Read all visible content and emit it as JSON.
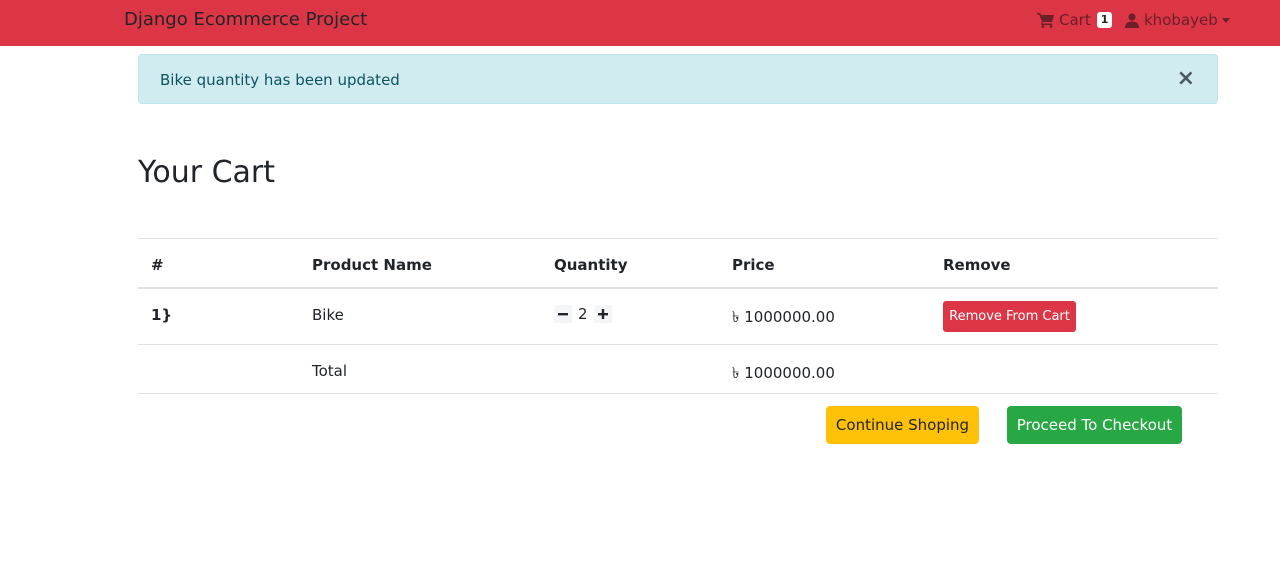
{
  "navbar": {
    "brand": "Django Ecommerce Project",
    "cart_label": "Cart",
    "cart_count": "1",
    "username": "khobayeb"
  },
  "alert": {
    "message": "Bike quantity has been updated",
    "close_glyph": "×"
  },
  "page_title": "Your Cart",
  "table": {
    "headers": [
      "#",
      "Product Name",
      "Quantity",
      "Price",
      "Remove"
    ],
    "rows": [
      {
        "index": "1}",
        "product": "Bike",
        "quantity": "2",
        "price": "৳ 1000000.00",
        "remove_label": "Remove From Cart"
      }
    ],
    "total_label": "Total",
    "total_value": "৳ 1000000.00"
  },
  "actions": {
    "continue_label": "Continue Shoping",
    "checkout_label": "Proceed To Checkout"
  },
  "colors": {
    "navbar": "#dc3545",
    "alert_bg": "#d1ecf1",
    "continue": "#ffc107",
    "checkout": "#28a745",
    "remove": "#dc3545"
  },
  "icons": {
    "cart": "shopping-cart-icon",
    "user": "user-icon",
    "minus": "minus-icon",
    "plus": "plus-icon"
  }
}
